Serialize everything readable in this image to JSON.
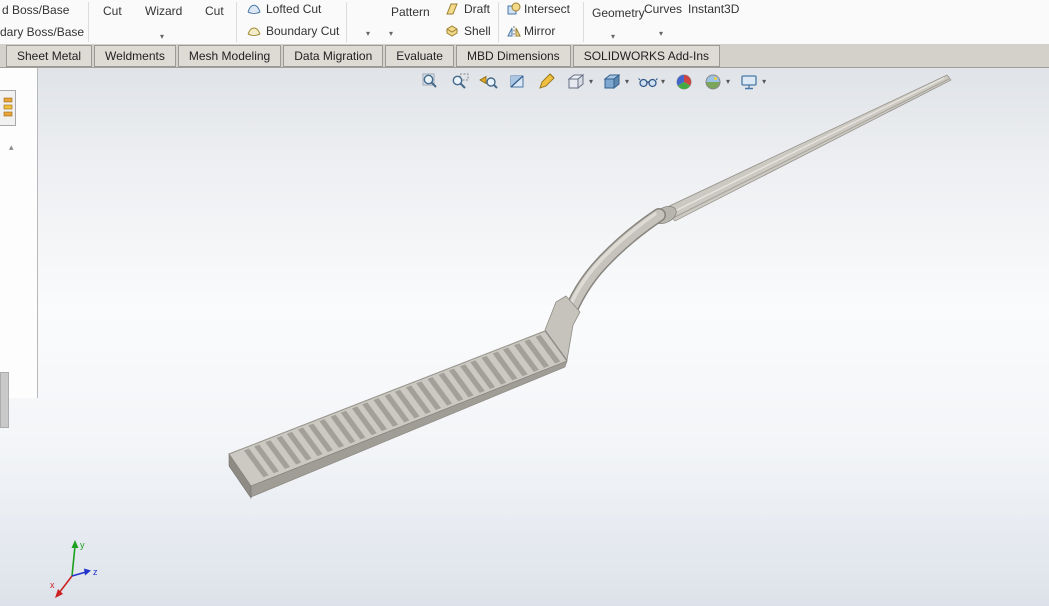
{
  "ribbon": {
    "extruded_boss_label": "d Boss/Base",
    "boundary_boss_label": "dary Boss/Base",
    "extruded_cut_label": "Cut",
    "hole_wizard_label": "Wizard",
    "revolved_cut_label": "Cut",
    "lofted_cut_label": "Lofted Cut",
    "boundary_cut_label": "Boundary Cut",
    "pattern_label": "Pattern",
    "draft_label": "Draft",
    "shell_label": "Shell",
    "intersect_label": "Intersect",
    "mirror_label": "Mirror",
    "reference_geometry_label": "Geometry",
    "curves_label": "Curves",
    "instant3d_label": "Instant3D"
  },
  "tabs": [
    "Sheet Metal",
    "Weldments",
    "Mesh Modeling",
    "Data Migration",
    "Evaluate",
    "MBD Dimensions",
    "SOLIDWORKS Add-Ins"
  ],
  "headsup": {
    "icons": [
      "zoom-to-fit",
      "zoom-to-area",
      "previous-view",
      "section-view",
      "dynamic-annotation-views",
      "view-orientation",
      "display-style",
      "hide-show-items",
      "edit-appearance",
      "apply-scene",
      "view-settings"
    ]
  },
  "glyphs": {
    "dropdown": "▾",
    "scroll_up": "▴"
  },
  "triad": {
    "x": "x",
    "y": "y",
    "z": "z"
  },
  "colors": {
    "model_body": "#ccc9c2",
    "model_side": "#a09d96",
    "model_teeth": "#a3a099",
    "viewport_top": "#e0e3e7",
    "viewport_bottom": "#dde2ea",
    "axis_x": "#cc2222",
    "axis_y": "#1fa01f",
    "axis_z": "#2233cc"
  }
}
